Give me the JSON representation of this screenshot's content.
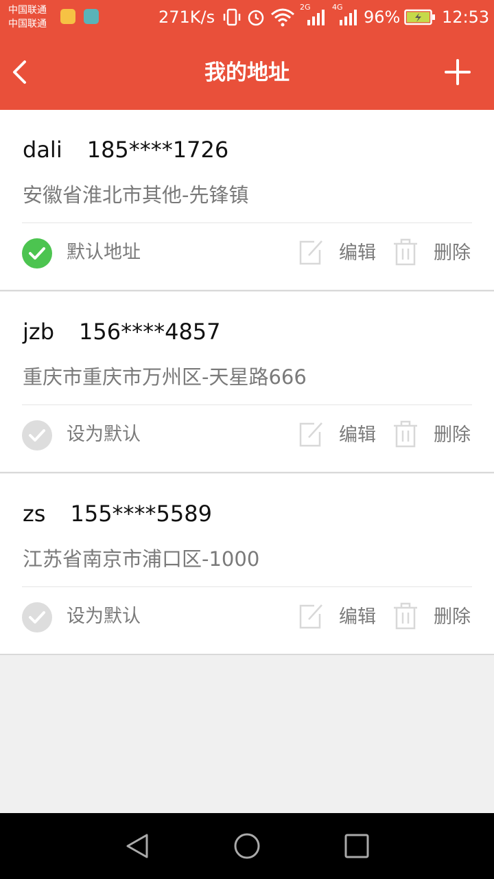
{
  "status_bar": {
    "carrier_1": "中国联通",
    "carrier_2": "中国联通",
    "net_speed": "271K/s",
    "signal_1_label": "2G",
    "signal_2_label": "4G",
    "battery": "96%",
    "time": "12:53",
    "icons": [
      "app-icon",
      "android-icon",
      "vibrate-icon",
      "alarm-icon",
      "wifi-icon",
      "signal-icon",
      "battery-charging-icon"
    ]
  },
  "header": {
    "title": "我的地址",
    "back_icon": "chevron-left-icon",
    "add_icon": "plus-icon",
    "bg_color": "#e9503a"
  },
  "addresses": [
    {
      "name": "dali",
      "phone": "185****1726",
      "address": "安徽省淮北市其他-先锋镇",
      "default_label": "默认地址",
      "is_default": true,
      "edit_label": "编辑",
      "delete_label": "删除"
    },
    {
      "name": "jzb",
      "phone": "156****4857",
      "address": "重庆市重庆市万州区-天星路666",
      "default_label": "设为默认",
      "is_default": false,
      "edit_label": "编辑",
      "delete_label": "删除"
    },
    {
      "name": "zs",
      "phone": "155****5589",
      "address": "江苏省南京市浦口区-1000",
      "default_label": "设为默认",
      "is_default": false,
      "edit_label": "编辑",
      "delete_label": "删除"
    }
  ],
  "colors": {
    "accent": "#e9503a",
    "default_check": "#4cc450",
    "inactive_check": "#dddddd",
    "secondary_text": "#7a7a7a"
  },
  "nav_bar": {
    "icons": [
      "back-triangle-icon",
      "home-circle-icon",
      "recents-square-icon"
    ]
  }
}
